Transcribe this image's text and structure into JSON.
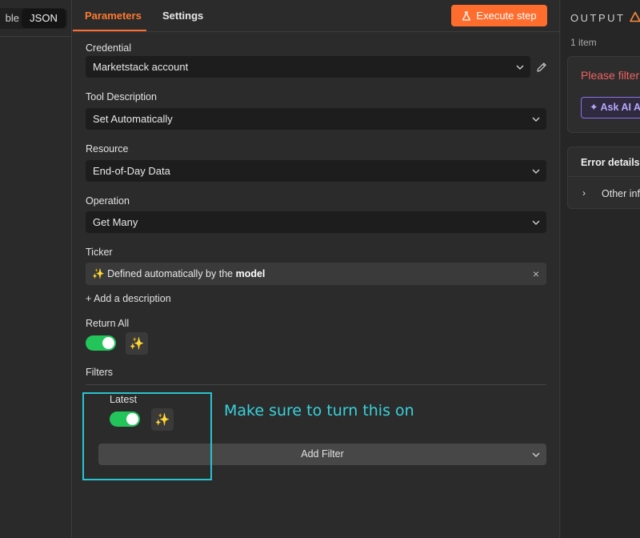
{
  "left_panel": {
    "tab_table_label": "ble",
    "tab_json_label": "JSON"
  },
  "tabs": {
    "parameters": "Parameters",
    "settings": "Settings"
  },
  "execute_button": "Execute step",
  "fields": {
    "credential": {
      "label": "Credential",
      "value": "Marketstack account"
    },
    "tool_description": {
      "label": "Tool Description",
      "value": "Set Automatically"
    },
    "resource": {
      "label": "Resource",
      "value": "End-of-Day Data"
    },
    "operation": {
      "label": "Operation",
      "value": "Get Many"
    },
    "ticker": {
      "label": "Ticker",
      "prefix_icon": "✨",
      "text_before": "Defined automatically by the",
      "text_bold": "model",
      "close_icon": "×"
    },
    "add_description": "+ Add a description",
    "return_all": {
      "label": "Return All",
      "enabled": true
    },
    "filters_label": "Filters",
    "latest": {
      "label": "Latest",
      "enabled": true
    },
    "add_filter": "Add Filter"
  },
  "annotation": "Make sure to turn this on",
  "output": {
    "title": "OUTPUT",
    "item_count": "1 item",
    "error_message": "Please filter",
    "ask_ai_label": "Ask AI A",
    "error_details_title": "Error details",
    "other_info_label": "Other inf"
  },
  "colors": {
    "accent": "#ff6d2e",
    "toggle_on": "#23c45a",
    "annotation": "#38d2dc",
    "error": "#ef6262",
    "ai_purple": "#8b72e8"
  },
  "icons": {
    "sparkle": "✨",
    "chevron": "chevron-down-icon",
    "pencil": "pencil-icon",
    "flask": "flask-icon",
    "warning": "warning-triangle-icon"
  }
}
